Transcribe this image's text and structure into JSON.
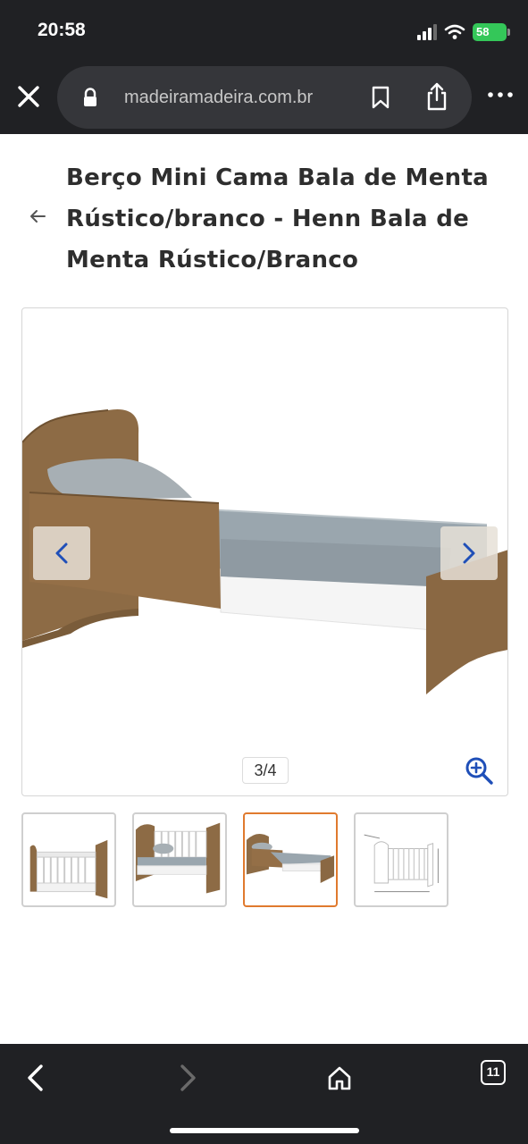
{
  "status_bar": {
    "time": "20:58",
    "battery": "58"
  },
  "browser": {
    "url_text": "madeiramadeira.com.br",
    "close_label": "close-tab",
    "open_tabs_count": "11"
  },
  "product": {
    "title": "Berço Mini Cama Bala de Menta Rústico/branco - Henn Bala de Menta Rústico/Branco"
  },
  "gallery": {
    "counter": "3/4",
    "current_index": 3,
    "total": 4,
    "selected_thumb": 3
  },
  "colors": {
    "chrome_bg": "#202124",
    "url_pill_bg": "#35363a",
    "accent_nav": "#1f4fb8",
    "thumb_active_border": "#e07a2e",
    "battery_green": "#34c759",
    "wood": "#8a6a44",
    "sheet": "#9aa6ae"
  },
  "icons": {
    "close": "close-icon",
    "lock": "lock-icon",
    "bookmark": "bookmark-icon",
    "share": "share-icon",
    "more": "more-icon",
    "back": "back-arrow-icon",
    "prev": "chevron-left-icon",
    "next": "chevron-right-icon",
    "zoom": "zoom-in-icon",
    "home": "home-icon"
  }
}
